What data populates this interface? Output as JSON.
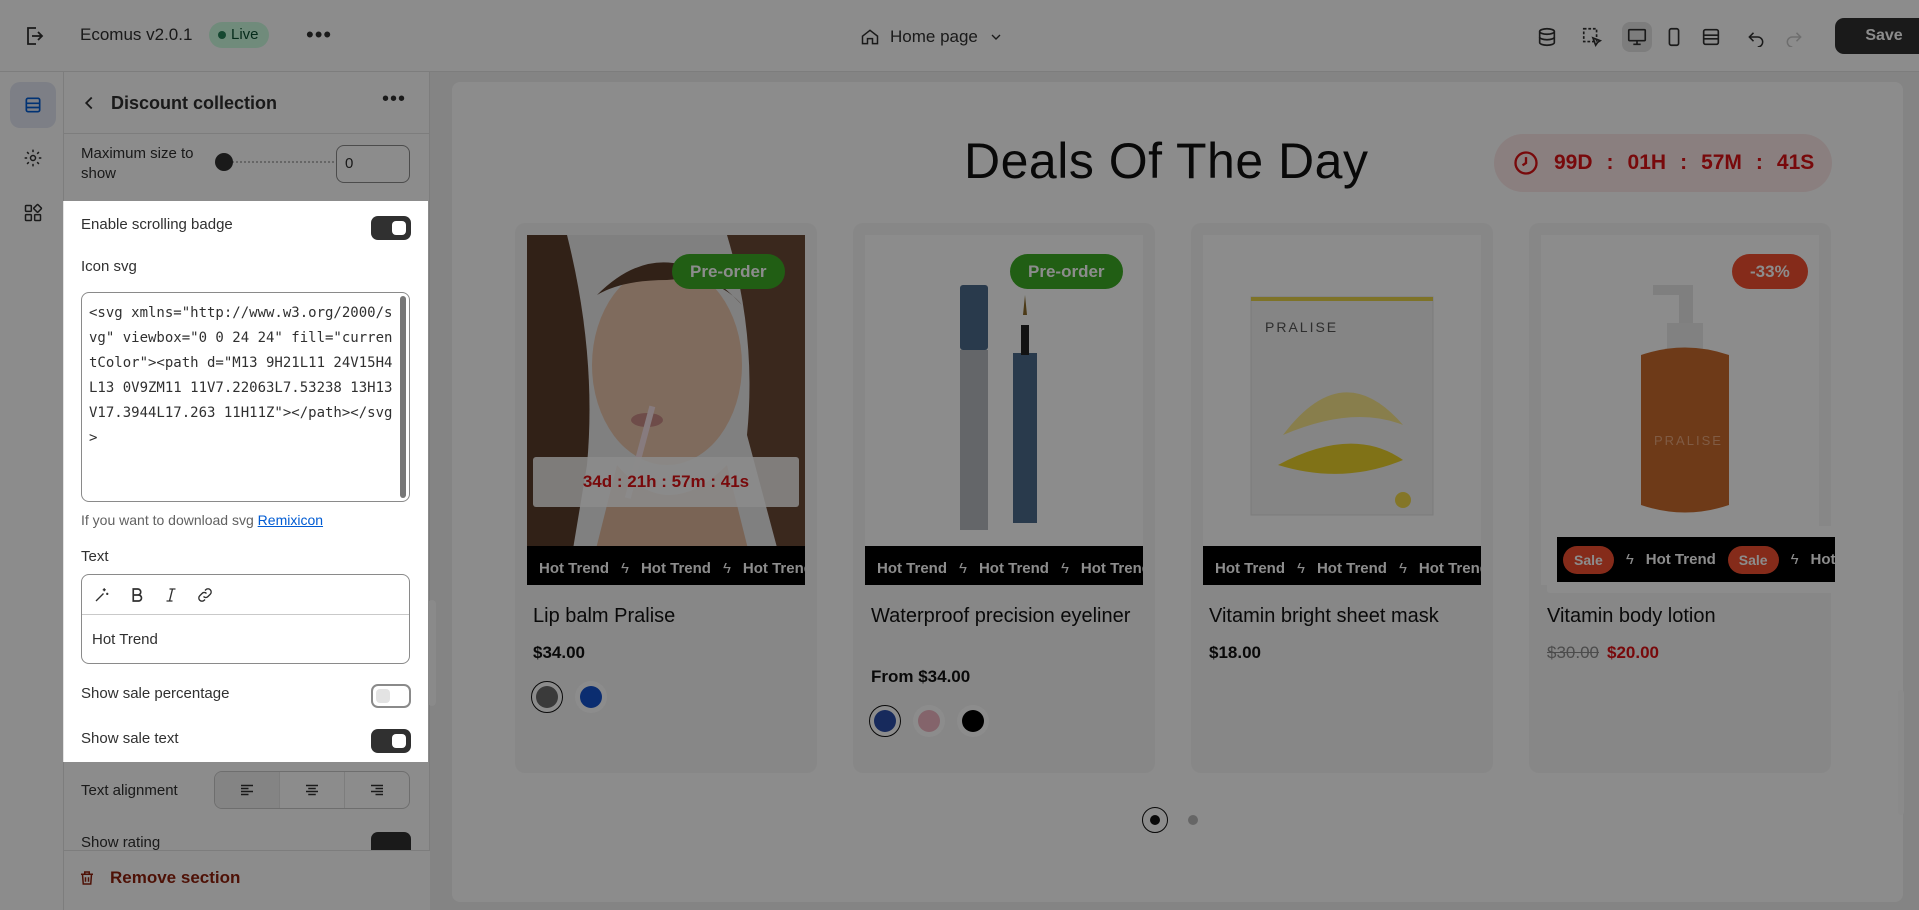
{
  "app": {
    "title": "Ecomus v2.0.1",
    "status": "Live",
    "page_selector": "Home page",
    "save_label": "Save"
  },
  "panel": {
    "title": "Discount collection",
    "max_size_label": "Maximum size to show",
    "max_size_value": "0",
    "enable_badge_label": "Enable scrolling badge",
    "icon_svg_label": "Icon svg",
    "icon_svg_value": "<svg xmlns=\"http://www.w3.org/2000/svg\" viewbox=\"0 0 24 24\" fill=\"currentColor\"><path d=\"M13 9H21L11 24V15H4L13 0V9ZM11 11V7.22063L7.53238 13H13V17.3944L17.263 11H11Z\"></path></svg>",
    "help_prefix": "If you want to download svg ",
    "help_link": "Remixicon",
    "text_label": "Text",
    "text_value": "Hot Trend",
    "show_sale_pct_label": "Show sale percentage",
    "show_sale_text_label": "Show sale text",
    "text_alignment_label": "Text alignment",
    "show_rating_label": "Show rating",
    "remove_label": "Remove section",
    "toggles": {
      "enable_badge": true,
      "show_sale_pct": false,
      "show_sale_text": true,
      "show_rating": true
    }
  },
  "preview": {
    "heading": "Deals Of The Day",
    "timer": [
      "99D",
      ":",
      "01H",
      ":",
      "57M",
      ":",
      "41S"
    ],
    "marquee_text": "Hot Trend",
    "sale_text": "Sale",
    "products": [
      {
        "title": "Lip balm Pralise",
        "price": "$34.00",
        "badge": "Pre-order",
        "countdown": "34d : 21h : 57m : 41s",
        "swatches": [
          "#6b6b6b",
          "#1452cc"
        ]
      },
      {
        "title": "Waterproof precision eyeliner",
        "price": "From $34.00",
        "badge": "Pre-order",
        "swatches": [
          "#2a4ea8",
          "#f0b7c3",
          "#000000"
        ]
      },
      {
        "title": "Vitamin bright sheet mask",
        "price": "$18.00"
      },
      {
        "title": "Vitamin body lotion",
        "price_old": "$30.00",
        "price_new": "$20.00",
        "badge": "-33%"
      }
    ],
    "brand_label": "PRALISE"
  },
  "colors": {
    "accent_red": "#db1215",
    "badge_green": "#3dab25",
    "badge_red": "#f24f30",
    "live_green": "#29845a"
  }
}
